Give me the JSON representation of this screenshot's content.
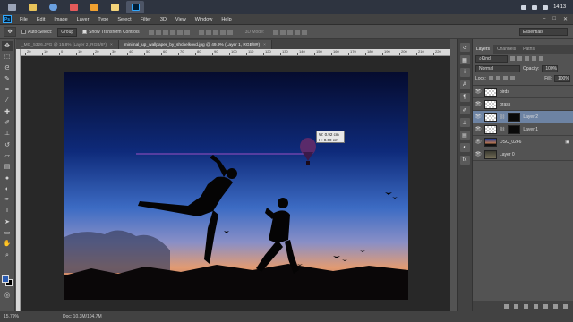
{
  "taskbar": {
    "time": "14:13",
    "apps": [
      {
        "name": "start",
        "color": "#9aa4b8"
      },
      {
        "name": "file-explorer",
        "color": "#e8c35a"
      },
      {
        "name": "browser-globe",
        "color": "#6aa0e0"
      },
      {
        "name": "media-player",
        "color": "#e35a5a"
      },
      {
        "name": "app-orange",
        "color": "#f0a030"
      },
      {
        "name": "folder",
        "color": "#f3d37a"
      },
      {
        "name": "photoshop",
        "color": "#31a8ff"
      }
    ]
  },
  "menubar": {
    "logo": "Ps",
    "items": [
      "File",
      "Edit",
      "Image",
      "Layer",
      "Type",
      "Select",
      "Filter",
      "3D",
      "View",
      "Window",
      "Help"
    ]
  },
  "options": {
    "auto_select_label": "Auto-Select:",
    "auto_select_value": "Group",
    "show_transform_label": "Show Transform Controls",
    "mode_3d_label": "3D Mode:",
    "workspace": "Essentials"
  },
  "doc_tabs": [
    {
      "title": "_MG_5326.JPG @ 15.8% (Layer 2, RGB/8*)",
      "active": false
    },
    {
      "title": "minimal_up_wallpaper_by_shchelkovd.jpg @ 49.9% (Layer 1, RGB/8#)",
      "active": true
    }
  ],
  "ruler_ticks": [
    "20",
    "10",
    "0",
    "10",
    "20",
    "30",
    "40",
    "50",
    "60",
    "70",
    "80",
    "90",
    "100",
    "110",
    "120",
    "130",
    "140",
    "150",
    "160",
    "170",
    "180",
    "190",
    "200",
    "210",
    "220",
    "230",
    "240"
  ],
  "readout": {
    "w": "W: 0.92 cm",
    "h": "H: 0.00 cm"
  },
  "status": {
    "zoom": "15.79%",
    "doc": "Doc: 10.3M/104.7M"
  },
  "panel": {
    "tabs": [
      "Layers",
      "Channels",
      "Paths"
    ],
    "kind_label": "Kind",
    "blend_mode": "Normal",
    "opacity_label": "Opacity:",
    "opacity_value": "100%",
    "lock_label": "Lock:",
    "fill_label": "Fill:",
    "fill_value": "100%",
    "layers": [
      {
        "name": "birds",
        "thumb": "checker",
        "selected": false,
        "mask": false
      },
      {
        "name": "grass",
        "thumb": "checker",
        "selected": false,
        "mask": false
      },
      {
        "name": "Layer 2",
        "thumb": "checker",
        "selected": true,
        "mask": true
      },
      {
        "name": "Layer 1",
        "thumb": "checker",
        "selected": false,
        "mask": true
      },
      {
        "name": "DSC_0246",
        "thumb": "photo",
        "selected": false,
        "mask": false
      },
      {
        "name": "Layer 0",
        "thumb": "bg",
        "selected": false,
        "mask": false
      }
    ]
  }
}
